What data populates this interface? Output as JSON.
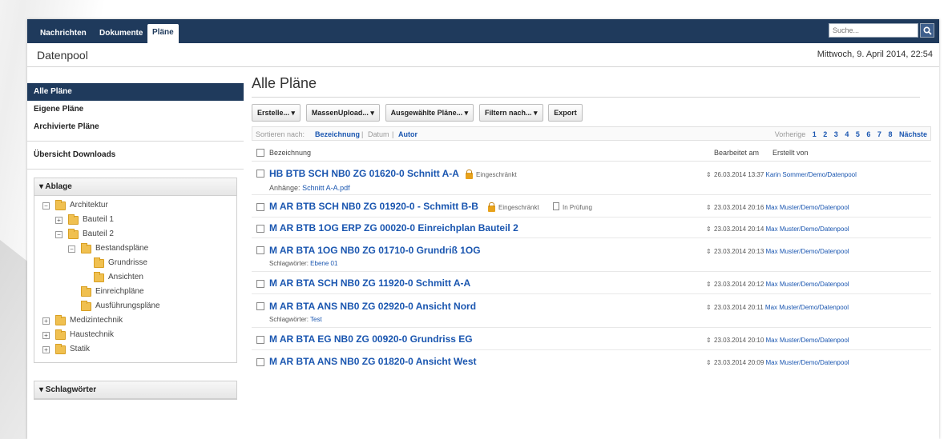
{
  "nav": {
    "tabs": [
      {
        "label": "Nachrichten"
      },
      {
        "label": "Dokumente"
      },
      {
        "label": "Pläne"
      }
    ],
    "search_placeholder": "Suche..."
  },
  "header": {
    "app_title": "Datenpool",
    "date": "Mittwoch, 9. April 2014, 22:54"
  },
  "sidebar": {
    "items": [
      {
        "label": "Alle Pläne"
      },
      {
        "label": "Eigene Pläne"
      },
      {
        "label": "Archivierte Pläne"
      },
      {
        "label": "Übersicht Downloads"
      }
    ],
    "ablage_title": "▾ Ablage",
    "tree": [
      {
        "label": "Architektur",
        "toggle": "−"
      },
      {
        "label": "Bauteil 1",
        "toggle": "+"
      },
      {
        "label": "Bauteil 2",
        "toggle": "−"
      },
      {
        "label": "Bestandspläne",
        "toggle": "−"
      },
      {
        "label": "Grundrisse"
      },
      {
        "label": "Ansichten"
      },
      {
        "label": "Einreichpläne"
      },
      {
        "label": "Ausführungspläne"
      },
      {
        "label": "Medizintechnik",
        "toggle": "+"
      },
      {
        "label": "Haustechnik",
        "toggle": "+"
      },
      {
        "label": "Statik",
        "toggle": "+"
      }
    ],
    "schlagwoerter_title": "▾ Schlagwörter"
  },
  "main": {
    "title": "Alle Pläne",
    "toolbar": [
      {
        "label": "Erstelle... ▾"
      },
      {
        "label": "MassenUpload... ▾"
      },
      {
        "label": "Ausgewählte Pläne... ▾"
      },
      {
        "label": "Filtern nach... ▾"
      },
      {
        "label": "Export"
      }
    ],
    "sort": {
      "label": "Sortieren nach:",
      "bezeichnung": "Bezeichnung",
      "datum": "Datum",
      "autor": "Autor"
    },
    "pager": {
      "label": "Vorherige",
      "pages": [
        "1",
        "2",
        "3",
        "4",
        "5",
        "6",
        "7",
        "8"
      ],
      "next": "Nächste"
    },
    "columns": {
      "bezeichnung": "Bezeichnung",
      "bearbeitet": "Bearbeitet am",
      "erstellt": "Erstellt von"
    },
    "rows": [
      {
        "title": "HB BTB SCH NB0 ZG 01620-0 Schnitt A-A",
        "restricted": "Eingeschränkt",
        "sub_label": "Anhänge:",
        "sub_value": "Schnitt A-A.pdf",
        "date": "26.03.2014 13:37",
        "author": "Karin Sommer/Demo/Datenpool"
      },
      {
        "title": "M AR BTB SCH NB0 ZG 01920-0 - Schmitt B-B",
        "restricted": "Eingeschränkt",
        "status": "In Prüfung",
        "date": "23.03.2014 20:16",
        "author": "Max Muster/Demo/Datenpool"
      },
      {
        "title": "M AR BTB 1OG ERP ZG 00020-0 Einreichplan Bauteil 2",
        "date": "23.03.2014 20:14",
        "author": "Max Muster/Demo/Datenpool"
      },
      {
        "title": "M AR BTA 1OG NB0 ZG 01710-0 Grundriß 1OG",
        "sub_label": "Schlagwörter:",
        "sub_value": "Ebene 01",
        "date": "23.03.2014 20:13",
        "author": "Max Muster/Demo/Datenpool"
      },
      {
        "title": "M AR BTA SCH NB0 ZG 11920-0 Schmitt A-A",
        "date": "23.03.2014 20:12",
        "author": "Max Muster/Demo/Datenpool"
      },
      {
        "title": "M AR BTA ANS NB0 ZG 02920-0 Ansicht Nord",
        "sub_label": "Schlagwörter:",
        "sub_value": "Test",
        "date": "23.03.2014 20:11",
        "author": "Max Muster/Demo/Datenpool"
      },
      {
        "title": "M AR BTA EG NB0 ZG 00920-0 Grundriss EG",
        "date": "23.03.2014 20:10",
        "author": "Max Muster/Demo/Datenpool"
      },
      {
        "title": "M AR BTA ANS NB0 ZG 01820-0 Ansicht West",
        "date": "23.03.2014 20:09",
        "author": "Max Muster/Demo/Datenpool"
      }
    ]
  },
  "colors": {
    "navbar": "#1f3a5c",
    "link": "#1a56b0",
    "lock": "#e8a21b",
    "folder": "#f0c050"
  }
}
